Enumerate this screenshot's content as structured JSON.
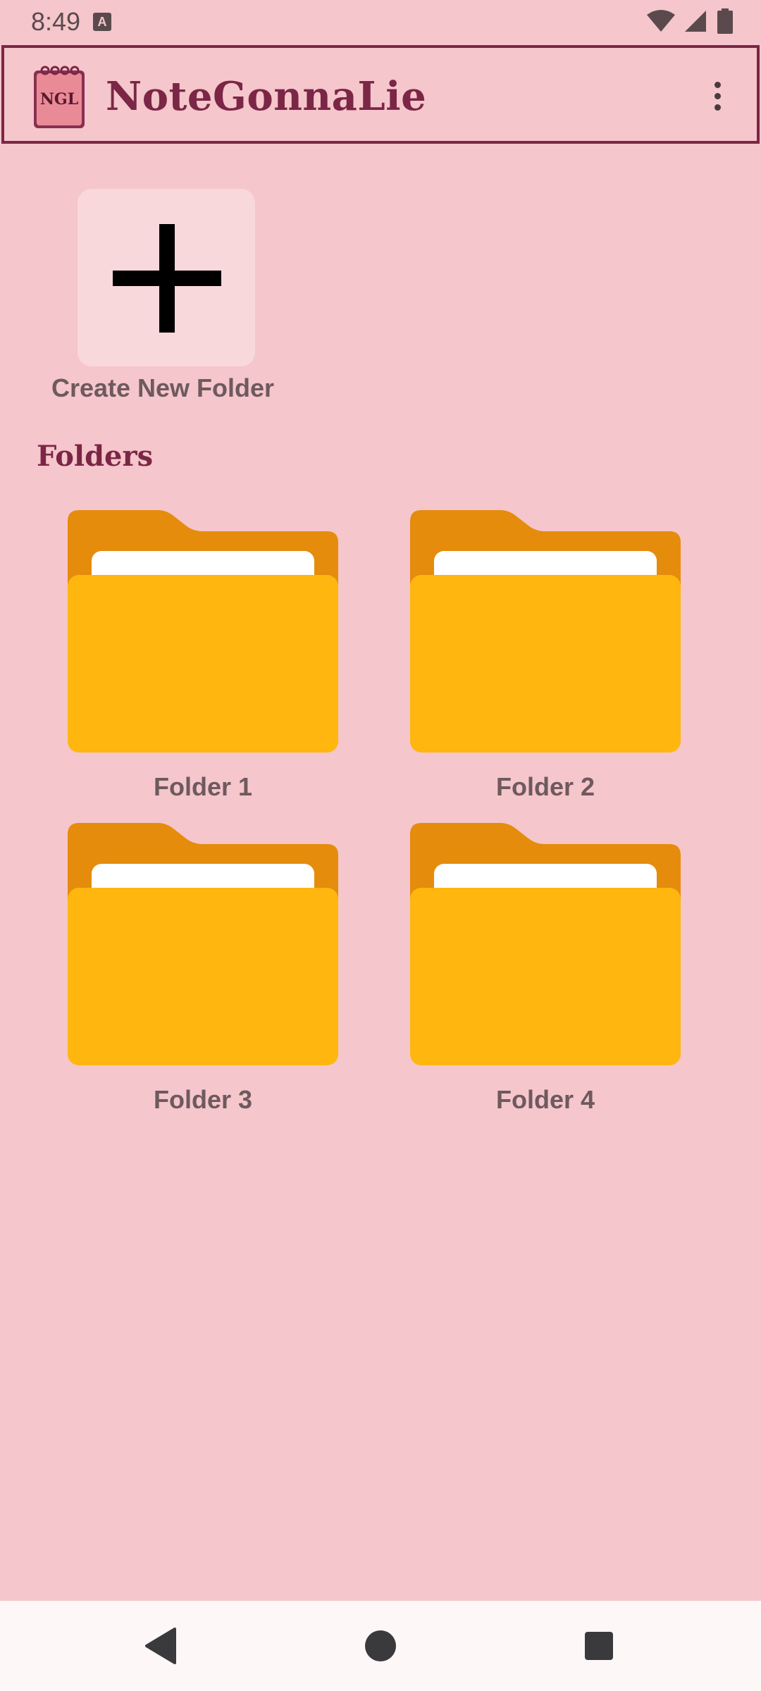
{
  "status_bar": {
    "time": "8:49",
    "notification_icon": "keyboard-a-icon",
    "icons": [
      "wifi-icon",
      "signal-icon",
      "battery-icon"
    ]
  },
  "app_bar": {
    "logo_text": "NGL",
    "title": "NoteGonnaLie",
    "menu_icon": "more-vert-icon"
  },
  "create_folder": {
    "icon": "plus-icon",
    "label": "Create New Folder"
  },
  "folders_section": {
    "heading": "Folders",
    "items": [
      {
        "label": "Folder 1",
        "icon": "folder-icon"
      },
      {
        "label": "Folder 2",
        "icon": "folder-icon"
      },
      {
        "label": "Folder 3",
        "icon": "folder-icon"
      },
      {
        "label": "Folder 4",
        "icon": "folder-icon"
      }
    ]
  },
  "nav_bar": {
    "buttons": [
      "back-icon",
      "home-icon",
      "recents-icon"
    ]
  },
  "colors": {
    "background": "#f5c6cb",
    "accent": "#7b2646",
    "folder_front": "#ffb60f",
    "folder_back": "#e58c0c",
    "tile": "#f9d8dc"
  }
}
